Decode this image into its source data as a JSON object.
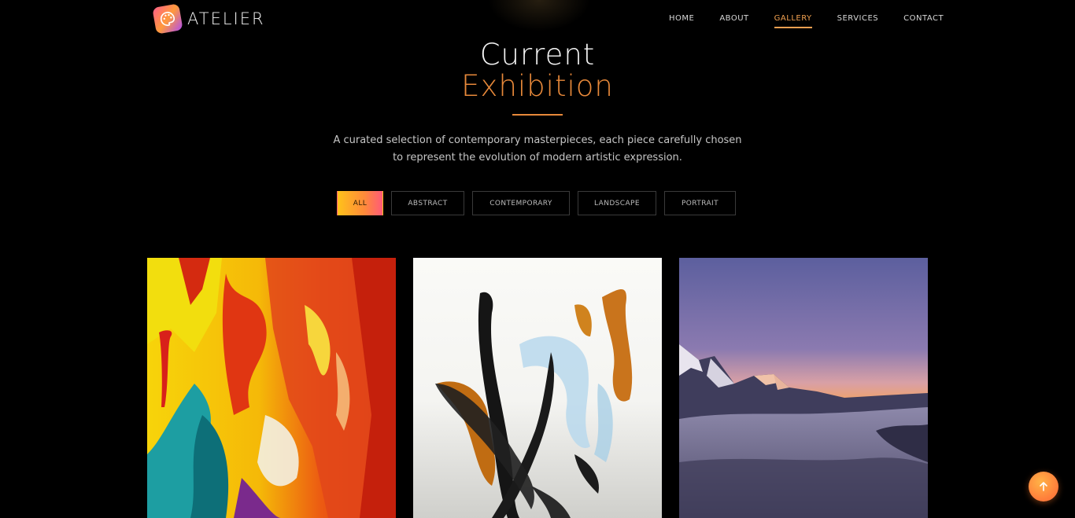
{
  "brand": {
    "name": "ATELIER",
    "icon": "palette-icon"
  },
  "nav": {
    "items": [
      {
        "label": "HOME",
        "active": false
      },
      {
        "label": "ABOUT",
        "active": false
      },
      {
        "label": "GALLERY",
        "active": true
      },
      {
        "label": "SERVICES",
        "active": false
      },
      {
        "label": "CONTACT",
        "active": false
      }
    ]
  },
  "hero": {
    "title_line1": "Current",
    "title_line2": "Exhibition",
    "description": "A curated selection of contemporary masterpieces, each piece carefully chosen to represent the evolution of modern artistic expression."
  },
  "filters": [
    {
      "label": "ALL",
      "active": true
    },
    {
      "label": "ABSTRACT",
      "active": false
    },
    {
      "label": "CONTEMPORARY",
      "active": false
    },
    {
      "label": "LANDSCAPE",
      "active": false
    },
    {
      "label": "PORTRAIT",
      "active": false
    }
  ],
  "gallery": {
    "artworks": [
      {
        "subject": "abstract-colorful-painting"
      },
      {
        "subject": "ink-brushstroke-painting"
      },
      {
        "subject": "mountain-landscape-photo"
      }
    ]
  },
  "scroll_top": {
    "icon": "arrow-up-icon"
  },
  "colors": {
    "accent": "#e8893a",
    "background": "#000000"
  }
}
